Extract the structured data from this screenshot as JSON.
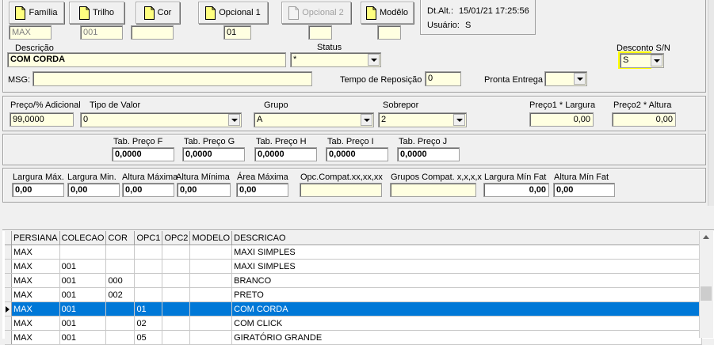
{
  "toolbar": {
    "buttons": [
      {
        "label": "Família",
        "enabled": true
      },
      {
        "label": "Trilho",
        "enabled": true
      },
      {
        "label": "Cor",
        "enabled": true
      },
      {
        "label": "Opcional 1",
        "enabled": true
      },
      {
        "label": "Opcional 2",
        "enabled": false
      },
      {
        "label": "Modêlo",
        "enabled": true
      }
    ],
    "codes": [
      "MAX",
      "001",
      "",
      "01",
      "",
      ""
    ]
  },
  "info": {
    "dt_alt_label": "Dt.Alt.:",
    "dt_alt_value": "15/01/21  17:25:56",
    "usuario_label": "Usuário:",
    "usuario_value": "S"
  },
  "form": {
    "descricao_label": "Descrição",
    "descricao_value": "COM CORDA",
    "status_label": "Status",
    "status_value": "*",
    "desconto_label": "Desconto S/N",
    "desconto_value": "S",
    "msg_label": "MSG:",
    "msg_value": "",
    "tempo_label": "Tempo de Reposição",
    "tempo_value": "0",
    "pronta_label": "Pronta Entrega",
    "pronta_value": ""
  },
  "pricing": {
    "preco_adicional_label": "Preço/% Adicional",
    "preco_adicional_value": "99,0000",
    "tipo_valor_label": "Tipo de Valor",
    "tipo_valor_value": "0",
    "grupo_label": "Grupo",
    "grupo_value": "A",
    "sobrepor_label": "Sobrepor",
    "sobrepor_value": "2",
    "preco1_label": "Preço1 * Largura",
    "preco1_value": "0,00",
    "preco2_label": "Preço2 * Altura",
    "preco2_value": "0,00"
  },
  "tabelas": [
    {
      "label": "Tab. Preço F",
      "value": "0,0000"
    },
    {
      "label": "Tab. Preço G",
      "value": "0,0000"
    },
    {
      "label": "Tab. Preço H",
      "value": "0,0000"
    },
    {
      "label": "Tab. Preço I",
      "value": "0,0000"
    },
    {
      "label": "Tab. Preço J",
      "value": "0,0000"
    }
  ],
  "dimensions": [
    {
      "label": "Largura Máx.",
      "value": "0,00"
    },
    {
      "label": "Largura Min.",
      "value": "0,00"
    },
    {
      "label": "Altura Máxima",
      "value": "0,00"
    },
    {
      "label": "Altura Mínima",
      "value": "0,00"
    },
    {
      "label": "Área Máxima",
      "value": "0,00"
    },
    {
      "label": "Opc.Compat.xx,xx,xx",
      "value": ""
    },
    {
      "label": "Grupos Compat. x,x,x,x",
      "value": ""
    },
    {
      "label": "Largura Mín Fat",
      "value": "0,00"
    },
    {
      "label": "Altura Mín Fat",
      "value": "0,00"
    }
  ],
  "grid": {
    "columns": [
      "PERSIANA",
      "COLECAO",
      "COR",
      "OPC1",
      "OPC2",
      "MODELO",
      "DESCRICAO"
    ],
    "rows": [
      [
        "MAX",
        "",
        "",
        "",
        "",
        "",
        "MAXI SIMPLES"
      ],
      [
        "MAX",
        "001",
        "",
        "",
        "",
        "",
        "MAXI SIMPLES"
      ],
      [
        "MAX",
        "001",
        "000",
        "",
        "",
        "",
        "BRANCO"
      ],
      [
        "MAX",
        "001",
        "002",
        "",
        "",
        "",
        "PRETO"
      ],
      [
        "MAX",
        "001",
        "",
        "01",
        "",
        "",
        "COM CORDA"
      ],
      [
        "MAX",
        "001",
        "",
        "02",
        "",
        "",
        "COM CLICK"
      ],
      [
        "MAX",
        "001",
        "",
        "05",
        "",
        "",
        "GIRATÓRIO GRANDE"
      ]
    ],
    "selected_row": 4
  },
  "colors": {
    "field_bg": "#ffffe1",
    "selection": "#0078d7",
    "highlight": "#ffff00"
  }
}
